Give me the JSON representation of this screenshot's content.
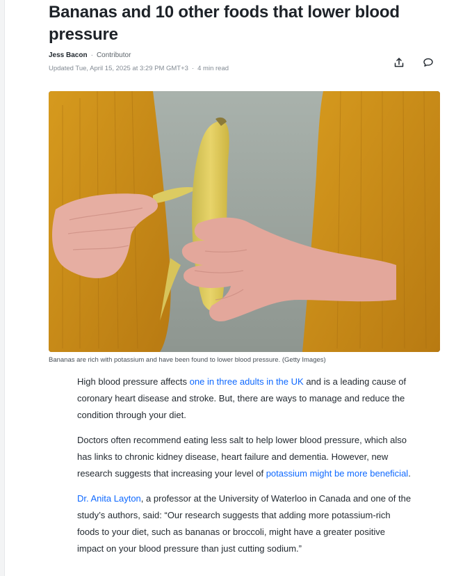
{
  "headline": "Bananas and 10 other foods that lower blood pressure",
  "byline": {
    "author": "Jess Bacon",
    "role": "Contributor",
    "updated": "Updated Tue, April 15, 2025 at 3:29 PM GMT+3",
    "read_time": "4 min read"
  },
  "actions": {
    "share_icon": "share-icon",
    "comment_icon": "comment-icon"
  },
  "image": {
    "caption": "Bananas are rich with potassium and have been found to lower blood pressure. (Getty Images)"
  },
  "paragraphs": {
    "p1": {
      "t1": "High blood pressure affects ",
      "link1": "one in three adults in the UK",
      "t2": " and is a leading cause of coronary heart disease and stroke. But, there are ways to manage and reduce the condition through your diet."
    },
    "p2": {
      "t1": "Doctors often recommend eating less salt to help lower blood pressure, which also has links to chronic kidney disease, heart failure and dementia. However, new research suggests that increasing your level of ",
      "link1": "potassium might be more beneficial",
      "t2": "."
    },
    "p3": {
      "link1": "Dr. Anita Layton",
      "t1": ", a professor at the University of Waterloo in Canada and one of the study’s authors, said: “Our research suggests that adding more potassium-rich foods to your diet, such as bananas or broccoli, might have a greater positive impact on your blood pressure than just cutting sodium.”"
    }
  },
  "colors": {
    "link": "#0f69ff",
    "text": "#232a31",
    "muted": "#828a93"
  }
}
